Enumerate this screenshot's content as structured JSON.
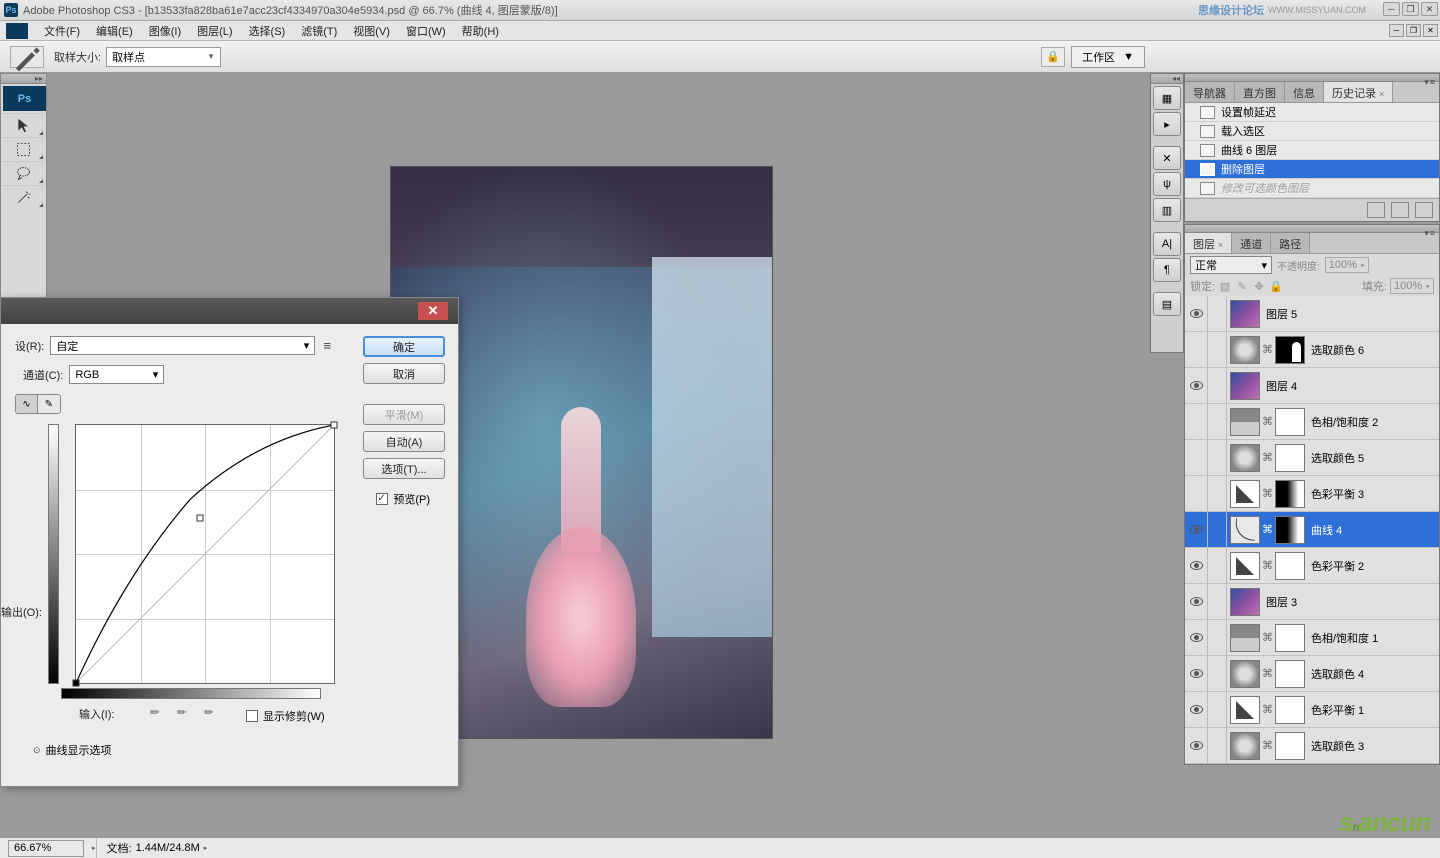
{
  "title": {
    "app": "Adobe Photoshop CS3",
    "doc": "[b13533fa828ba61e7acc23cf4334970a304e5934.psd @ 66.7% (曲线 4, 图层蒙版/8)]"
  },
  "forum": {
    "label": "思缘设计论坛",
    "url": "WWW.MISSYUAN.COM"
  },
  "menu": {
    "items": [
      "文件(F)",
      "编辑(E)",
      "图像(I)",
      "图层(L)",
      "选择(S)",
      "滤镜(T)",
      "视图(V)",
      "窗口(W)",
      "帮助(H)"
    ]
  },
  "optbar": {
    "sample_label": "取样大小:",
    "sample_value": "取样点",
    "ws_label": "工作区"
  },
  "curves": {
    "preset_label": "设(R):",
    "preset_value": "自定",
    "channel_label": "通道(C):",
    "channel_value": "RGB",
    "output_label": "输出(O):",
    "input_label": "输入(I):",
    "show_clip": "显示修剪(W)",
    "expand": "曲线显示选项",
    "btn_ok": "确定",
    "btn_cancel": "取消",
    "btn_smooth": "平滑(M)",
    "btn_auto": "自动(A)",
    "btn_options": "选项(T)...",
    "preview": "预览(P)"
  },
  "panels": {
    "hist_tabs": [
      "导航器",
      "直方图",
      "信息",
      "历史记录"
    ],
    "history": [
      {
        "label": "设置帧延迟",
        "sel": false
      },
      {
        "label": "载入选区",
        "sel": false
      },
      {
        "label": "曲线 6 图层",
        "sel": false
      },
      {
        "label": "删除图层",
        "sel": true
      },
      {
        "label": "修改可选颜色图层",
        "sel": false,
        "dim": true
      }
    ],
    "lyr_tabs": [
      "图层",
      "通道",
      "路径"
    ],
    "blend": "正常",
    "opacity_label": "不透明度:",
    "opacity": "100%",
    "lock_label": "锁定:",
    "fill_label": "填充:",
    "fill": "100%",
    "layers": [
      {
        "name": "图层 5",
        "type": "img",
        "vis": true
      },
      {
        "name": "选取颜色 6",
        "type": "adj",
        "mask": "sil",
        "vis": false
      },
      {
        "name": "图层 4",
        "type": "img",
        "vis": true
      },
      {
        "name": "色相/饱和度 2",
        "type": "hsl",
        "mask": "w",
        "vis": false
      },
      {
        "name": "选取颜色 5",
        "type": "adj",
        "mask": "w",
        "vis": false
      },
      {
        "name": "色彩平衡 3",
        "type": "cbal",
        "mask": "mix",
        "vis": false
      },
      {
        "name": "曲线 4",
        "type": "curve",
        "mask": "mix",
        "vis": true,
        "sel": true
      },
      {
        "name": "色彩平衡 2",
        "type": "cbal",
        "mask": "w",
        "vis": true
      },
      {
        "name": "图层 3",
        "type": "img",
        "vis": true
      },
      {
        "name": "色相/饱和度 1",
        "type": "hsl",
        "mask": "w",
        "vis": true
      },
      {
        "name": "选取颜色 4",
        "type": "adj",
        "mask": "w",
        "vis": true
      },
      {
        "name": "色彩平衡 1",
        "type": "cbal",
        "mask": "w",
        "vis": true
      },
      {
        "name": "选取颜色 3",
        "type": "adj",
        "mask": "w",
        "vis": true
      }
    ]
  },
  "status": {
    "zoom": "66.67%",
    "doc_label": "文档:",
    "doc_size": "1.44M/24.8M"
  },
  "watermark": "shancun"
}
